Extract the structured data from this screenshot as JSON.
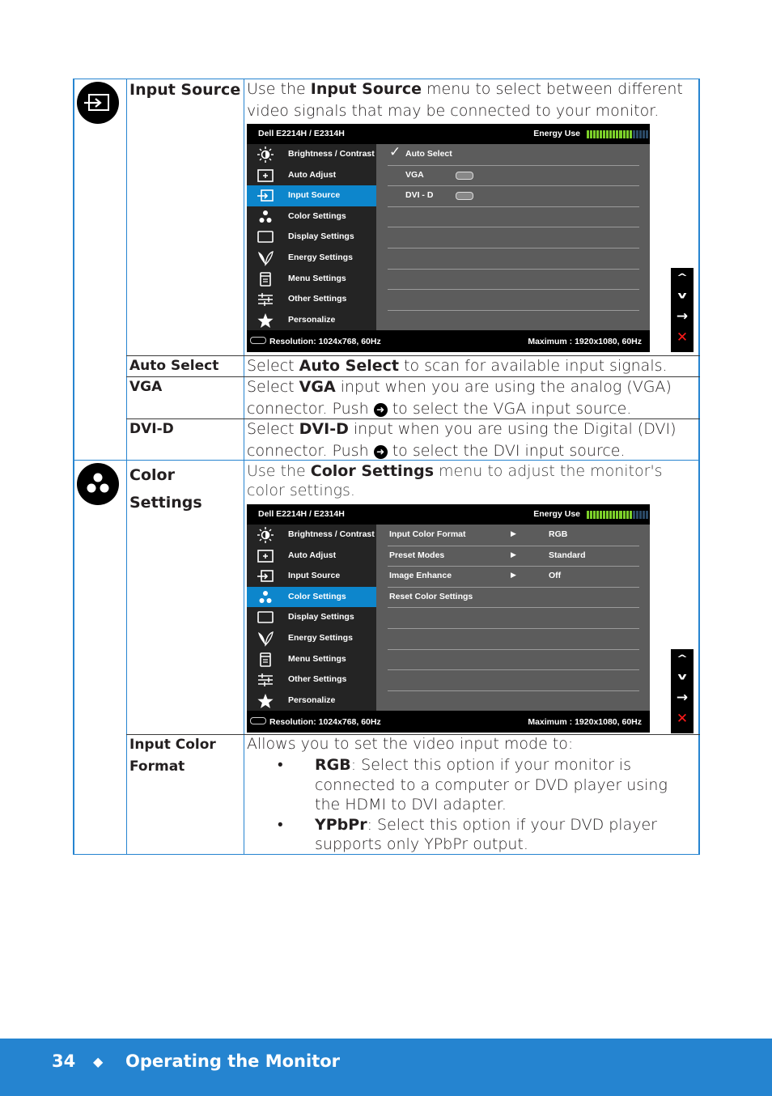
{
  "sections": [
    {
      "icon": "input-source-icon",
      "title": "Input Source",
      "description_prefix": "Use the ",
      "description_bold": "Input Source",
      "description_suffix": " menu to select between different video signals that may be connected to your monitor.",
      "osd": {
        "model": "Dell E2214H / E2314H",
        "energy_label": "Energy Use",
        "energy_level_fraction": 0.74,
        "menu_items": [
          {
            "icon": "brightness-icon",
            "label": "Brightness / Contrast"
          },
          {
            "icon": "auto-adjust-icon",
            "label": "Auto Adjust"
          },
          {
            "icon": "input-source-icon",
            "label": "Input Source",
            "active": true
          },
          {
            "icon": "color-settings-icon",
            "label": "Color Settings"
          },
          {
            "icon": "display-settings-icon",
            "label": "Display Settings"
          },
          {
            "icon": "energy-settings-icon",
            "label": "Energy Settings"
          },
          {
            "icon": "menu-settings-icon",
            "label": "Menu Settings"
          },
          {
            "icon": "other-settings-icon",
            "label": "Other Settings"
          },
          {
            "icon": "personalize-icon",
            "label": "Personalize"
          }
        ],
        "options": [
          {
            "label": "Auto Select",
            "checked": true
          },
          {
            "label": "VGA",
            "connector": "vga-connector-icon"
          },
          {
            "label": "DVI - D",
            "connector": "dvi-connector-icon"
          }
        ],
        "resolution": "Resolution: 1024x768,   60Hz",
        "maximum": "Maximum : 1920x1080,   60Hz"
      },
      "nav_buttons": [
        "up",
        "down",
        "enter",
        "exit"
      ],
      "rows": [
        {
          "label": "Auto Select",
          "pre": "Select ",
          "bold": "Auto Select",
          "post": " to scan for available input signals."
        },
        {
          "label": "VGA",
          "pre": "Select ",
          "bold": "VGA",
          "post": " input when you are using the analog (VGA)",
          "line2_pre": "connector. Push ",
          "line2_post": " to select the VGA input source."
        },
        {
          "label": "DVI-D",
          "pre": "Select ",
          "bold": "DVI-D",
          "post": " input when you are using the Digital (DVI)",
          "line2_pre": "connector. Push ",
          "line2_post": " to select the DVI input source."
        }
      ]
    },
    {
      "icon": "color-settings-icon",
      "title_line1": "Color",
      "title_line2": "Settings",
      "description_prefix": "Use the ",
      "description_bold": "Color Settings",
      "description_suffix": " menu to adjust the monitor's color settings.",
      "osd": {
        "model": "Dell E2214H / E2314H",
        "energy_label": "Energy Use",
        "energy_level_fraction": 0.74,
        "menu_items": [
          {
            "icon": "brightness-icon",
            "label": "Brightness / Contrast"
          },
          {
            "icon": "auto-adjust-icon",
            "label": "Auto Adjust"
          },
          {
            "icon": "input-source-icon",
            "label": "Input Source"
          },
          {
            "icon": "color-settings-icon",
            "label": "Color Settings",
            "active": true
          },
          {
            "icon": "display-settings-icon",
            "label": "Display Settings"
          },
          {
            "icon": "energy-settings-icon",
            "label": "Energy Settings"
          },
          {
            "icon": "menu-settings-icon",
            "label": "Menu Settings"
          },
          {
            "icon": "other-settings-icon",
            "label": "Other Settings"
          },
          {
            "icon": "personalize-icon",
            "label": "Personalize"
          }
        ],
        "options": [
          {
            "label": "Input Color Format",
            "value": "RGB"
          },
          {
            "label": "Preset Modes",
            "value": "Standard"
          },
          {
            "label": "Image Enhance",
            "value": "Off"
          },
          {
            "label": "Reset Color Settings"
          }
        ],
        "resolution": "Resolution: 1024x768,   60Hz",
        "maximum": "Maximum : 1920x1080,   60Hz"
      },
      "rows": [
        {
          "label_line1": "Input Color",
          "label_line2": "Format",
          "intro": "Allows you to set the video input mode to:",
          "bullets": [
            {
              "bold": "RGB",
              "text": ": Select this option if your monitor is connected to a computer or DVD player using the HDMI to DVI adapter."
            },
            {
              "bold": "YPbPr",
              "text": ": Select this option if your DVD player supports only YPbPr output."
            }
          ]
        }
      ]
    }
  ],
  "glyphs": {
    "check": "✓",
    "submenu_arrow": "▶",
    "push_button": "➜",
    "nav_up": "^",
    "nav_down": "v",
    "nav_enter": "→",
    "nav_exit": "✕",
    "footer_diamond": "◆"
  },
  "colors": {
    "accent_blue": "#2584d0",
    "osd_highlight": "#0d86cc",
    "energy_green": "#7cd02a",
    "energy_unlit": "#2b4a66",
    "exit_red": "#ff1a1a"
  },
  "footer": {
    "page_number": "34",
    "title": "Operating the Monitor"
  }
}
